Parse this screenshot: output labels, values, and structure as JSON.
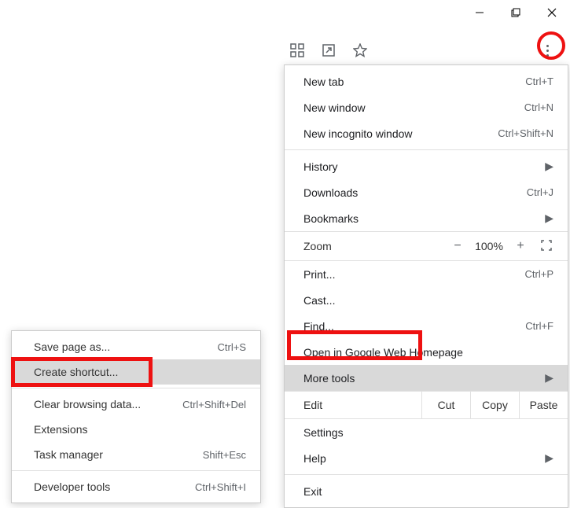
{
  "window_controls": {
    "minimize": "—",
    "maximize": "❐",
    "close": "✕"
  },
  "toolbar": {
    "qr_icon": "qr",
    "open_icon": "open",
    "star_icon": "star",
    "menu_icon": "menu"
  },
  "menu": {
    "new_tab": {
      "label": "New tab",
      "shortcut": "Ctrl+T"
    },
    "new_window": {
      "label": "New window",
      "shortcut": "Ctrl+N"
    },
    "new_incognito": {
      "label": "New incognito window",
      "shortcut": "Ctrl+Shift+N"
    },
    "history": {
      "label": "History"
    },
    "downloads": {
      "label": "Downloads",
      "shortcut": "Ctrl+J"
    },
    "bookmarks": {
      "label": "Bookmarks"
    },
    "zoom": {
      "label": "Zoom",
      "minus": "−",
      "value": "100%",
      "plus": "+",
      "fullscreen": "⛶"
    },
    "print": {
      "label": "Print...",
      "shortcut": "Ctrl+P"
    },
    "cast": {
      "label": "Cast..."
    },
    "find": {
      "label": "Find...",
      "shortcut": "Ctrl+F"
    },
    "open_homepage": {
      "label": "Open in Google Web Homepage"
    },
    "more_tools": {
      "label": "More tools"
    },
    "edit": {
      "label": "Edit",
      "cut": "Cut",
      "copy": "Copy",
      "paste": "Paste"
    },
    "settings": {
      "label": "Settings"
    },
    "help": {
      "label": "Help"
    },
    "exit": {
      "label": "Exit"
    }
  },
  "submenu": {
    "save_page": {
      "label": "Save page as...",
      "shortcut": "Ctrl+S"
    },
    "create_shortcut": {
      "label": "Create shortcut..."
    },
    "clear_browsing": {
      "label": "Clear browsing data...",
      "shortcut": "Ctrl+Shift+Del"
    },
    "extensions": {
      "label": "Extensions"
    },
    "task_manager": {
      "label": "Task manager",
      "shortcut": "Shift+Esc"
    },
    "dev_tools": {
      "label": "Developer tools",
      "shortcut": "Ctrl+Shift+I"
    }
  }
}
